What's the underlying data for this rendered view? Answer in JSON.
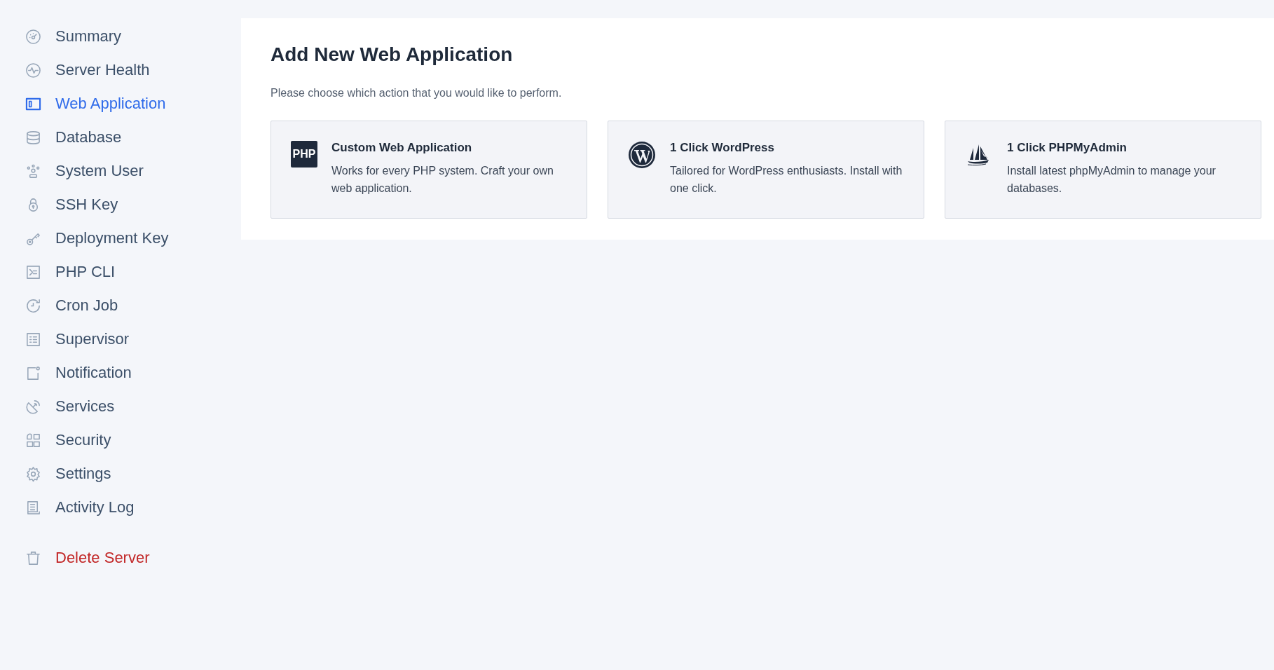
{
  "sidebar": {
    "items": [
      {
        "label": "Summary",
        "selected": false
      },
      {
        "label": "Server Health",
        "selected": false
      },
      {
        "label": "Web Application",
        "selected": true
      },
      {
        "label": "Database",
        "selected": false
      },
      {
        "label": "System User",
        "selected": false
      },
      {
        "label": "SSH Key",
        "selected": false
      },
      {
        "label": "Deployment Key",
        "selected": false
      },
      {
        "label": "PHP CLI",
        "selected": false
      },
      {
        "label": "Cron Job",
        "selected": false
      },
      {
        "label": "Supervisor",
        "selected": false
      },
      {
        "label": "Notification",
        "selected": false
      },
      {
        "label": "Services",
        "selected": false
      },
      {
        "label": "Security",
        "selected": false
      },
      {
        "label": "Settings",
        "selected": false
      },
      {
        "label": "Activity Log",
        "selected": false
      }
    ],
    "delete_action": {
      "label": "Delete Server"
    }
  },
  "panel": {
    "title": "Add New Web Application",
    "subtitle": "Please choose which action that you would like to perform.",
    "options": [
      {
        "kind": "php",
        "logo_text": "PHP",
        "title": "Custom Web Application",
        "description": "Works for every PHP system. Craft your own web application."
      },
      {
        "kind": "wordpress",
        "title": "1 Click WordPress",
        "description": "Tailored for WordPress enthusiasts. Install with one click."
      },
      {
        "kind": "sailboat",
        "title": "1 Click PHPMyAdmin",
        "description": "Install latest phpMyAdmin to manage your databases."
      }
    ]
  }
}
